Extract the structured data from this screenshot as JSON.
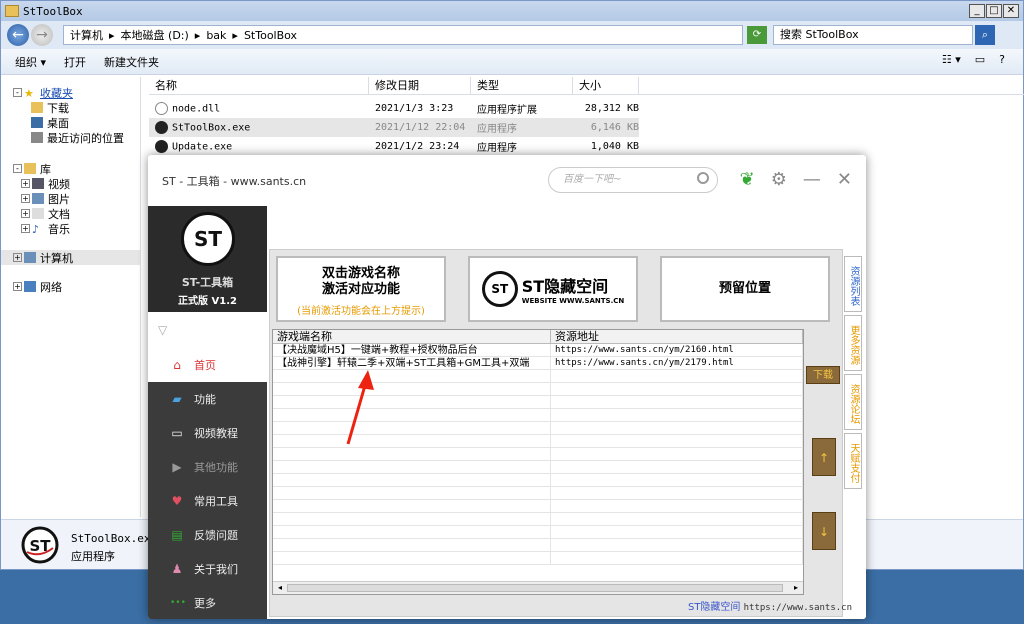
{
  "explorer": {
    "title": "StToolBox",
    "breadcrumbs": [
      "计算机",
      "本地磁盘 (D:)",
      "bak",
      "StToolBox"
    ],
    "search_placeholder": "搜索 StToolBox",
    "toolbar": {
      "organize": "组织 ▾",
      "open": "打开",
      "new_folder": "新建文件夹"
    },
    "nav": {
      "favorites": "收藏夹",
      "downloads": "下载",
      "desktop": "桌面",
      "recent": "最近访问的位置",
      "libraries": "库",
      "videos": "视频",
      "pictures": "图片",
      "documents": "文档",
      "music": "音乐",
      "computer": "计算机",
      "network": "网络"
    },
    "columns": [
      "名称",
      "修改日期",
      "类型",
      "大小"
    ],
    "files": [
      {
        "name": "node.dll",
        "date": "2021/1/3 3:23",
        "type": "应用程序扩展",
        "size": "28,312 KB"
      },
      {
        "name": "StToolBox.exe",
        "date": "2021/1/12 22:04",
        "type": "应用程序",
        "size": "6,146 KB"
      },
      {
        "name": "Update.exe",
        "date": "2021/1/2 23:24",
        "type": "应用程序",
        "size": "1,040 KB"
      }
    ],
    "details": {
      "name": "StToolBox.exe",
      "type": "应用程序"
    }
  },
  "st": {
    "title": "ST - 工具箱 - www.sants.cn",
    "search_placeholder": "百度一下吧~",
    "logo_text": "ST",
    "app_name": "ST-工具箱",
    "version": "正式版 V1.2",
    "menu": [
      {
        "label": "首页",
        "icon": "home-icon"
      },
      {
        "label": "功能",
        "icon": "folder-icon"
      },
      {
        "label": "视频教程",
        "icon": "monitor-icon"
      },
      {
        "label": "其他功能",
        "icon": "play-icon"
      },
      {
        "label": "常用工具",
        "icon": "heart-icon"
      },
      {
        "label": "反馈问题",
        "icon": "chat-icon"
      },
      {
        "label": "关于我们",
        "icon": "user-icon"
      },
      {
        "label": "更多",
        "icon": "dots-icon"
      }
    ],
    "card1_line1": "双击游戏名称",
    "card1_line2": "激活对应功能",
    "card1_note": "(当前激活功能会在上方提示)",
    "card2_brand": "ST隐藏空间",
    "card2_site": "WEBSITE WWW.SANTS.CN",
    "card3": "预留位置",
    "grid_headers": [
      "游戏端名称",
      "资源地址"
    ],
    "rows": [
      {
        "name": "【决战魔域H5】一键端+教程+授权物品后台",
        "url": "https://www.sants.cn/ym/2160.html"
      },
      {
        "name": "【战神引擎】轩辕二季+双端+ST工具箱+GM工具+双端",
        "url": "https://www.sants.cn/ym/2179.html"
      }
    ],
    "download": "下载",
    "up": "↑",
    "down": "↓",
    "tabs": [
      "资源列表",
      "更多资源",
      "资源论坛",
      "天赋支付"
    ],
    "footer_brand": "ST隐藏空间",
    "footer_url": "https://www.sants.cn"
  }
}
